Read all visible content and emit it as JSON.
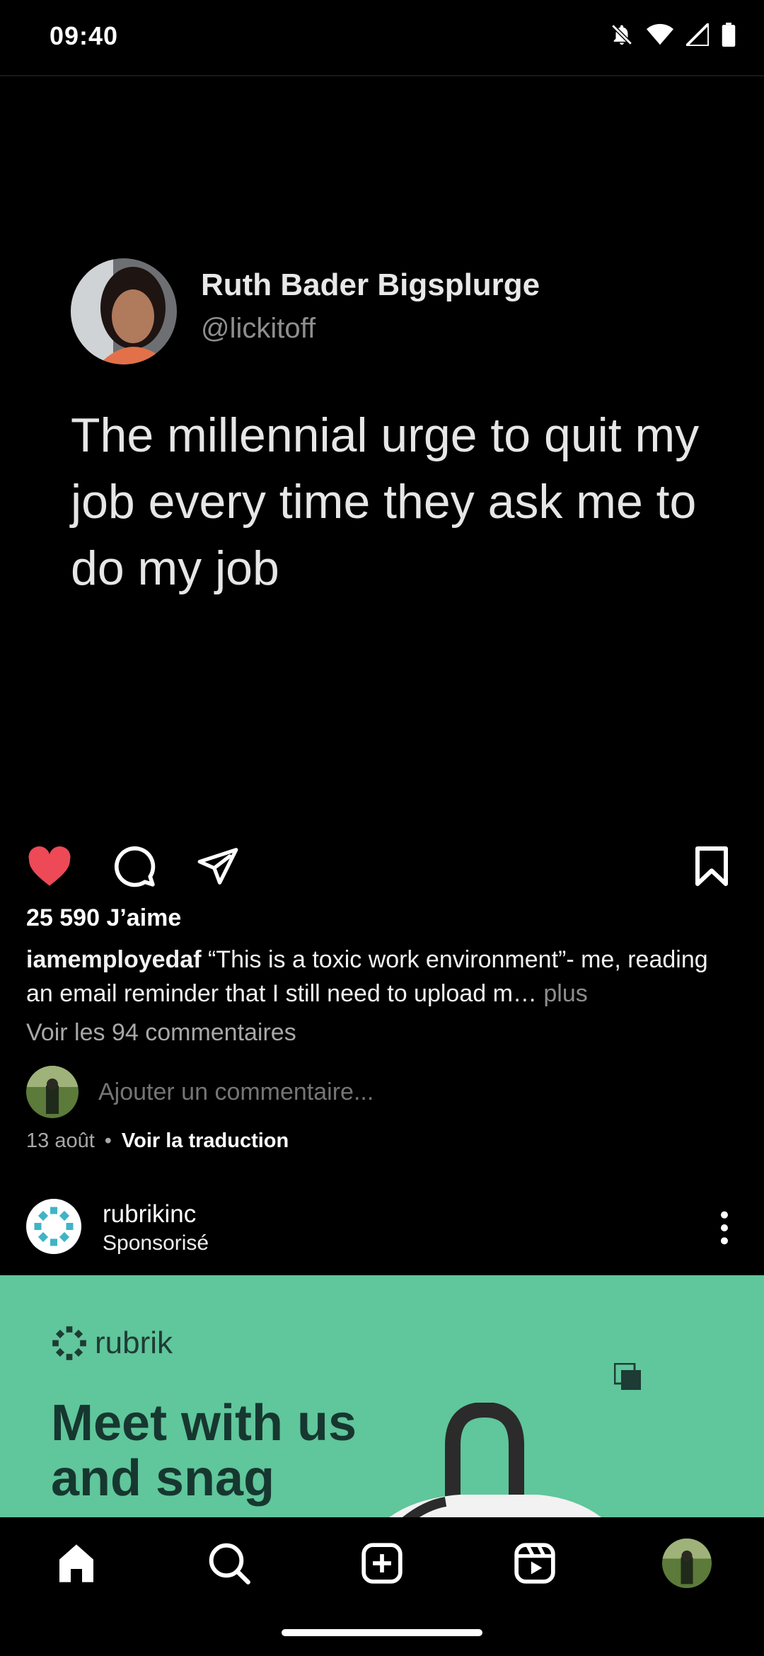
{
  "status_bar": {
    "time": "09:40",
    "icons": [
      "bell-off-icon",
      "wifi-icon",
      "signal-icon",
      "battery-icon"
    ]
  },
  "tweet": {
    "name": "Ruth Bader Bigsplurge",
    "handle": "@lickitoff",
    "text": "The millennial urge to quit my job every time they ask me to do my job"
  },
  "post": {
    "liked": true,
    "likes": "25 590 J’aime",
    "caption_user": "iamemployedaf",
    "caption_text": " “This is a toxic work environment”- me, reading an email reminder that I still need to upload m…",
    "caption_more": " plus",
    "view_comments": "Voir les 94 commentaires",
    "comment_placeholder": "Ajouter un commentaire...",
    "date": "13 août",
    "separator": "•",
    "translate": "Voir la traduction"
  },
  "sponsored": {
    "account": "rubrikinc",
    "label": "Sponsorisé",
    "ad_logo_text": "rubrik",
    "ad_headline": "Meet with us and snag"
  },
  "colors": {
    "like": "#ed4956",
    "ad_bg": "#60c69b",
    "ad_text": "#16372f"
  },
  "bottom_nav": [
    "home-icon",
    "search-icon",
    "create-icon",
    "reels-icon",
    "profile-avatar"
  ]
}
